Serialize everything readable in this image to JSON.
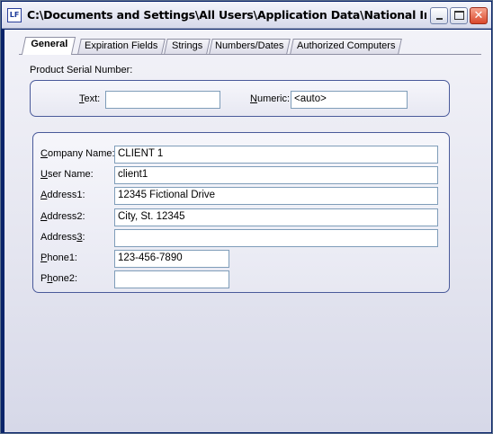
{
  "window": {
    "icon_text": "LF",
    "title": "C:\\Documents and Settings\\All Users\\Application Data\\National Instru...",
    "close_glyph": "✕"
  },
  "tabs": [
    {
      "label": "General",
      "active": true
    },
    {
      "label": "Expiration Fields"
    },
    {
      "label": "Strings"
    },
    {
      "label": "Numbers/Dates"
    },
    {
      "label": "Authorized Computers"
    }
  ],
  "serial": {
    "heading": "Product Serial Number:",
    "text_label": "Text:",
    "text_value": "",
    "numeric_label": "Numeric:",
    "numeric_value": "<auto>"
  },
  "customer": {
    "company_label": "Company Name:",
    "company_value": "CLIENT 1",
    "user_label": "User Name:",
    "user_value": "client1",
    "address1_label": "Address1:",
    "address1_value": "12345 Fictional Drive",
    "address2_label": "Address2:",
    "address2_value": "City, St. 12345",
    "address3_label": "Address3:",
    "address3_value": "",
    "phone1_label": "Phone1:",
    "phone1_value": "123-456-7890",
    "phone2_label": "Phone2:",
    "phone2_value": ""
  }
}
